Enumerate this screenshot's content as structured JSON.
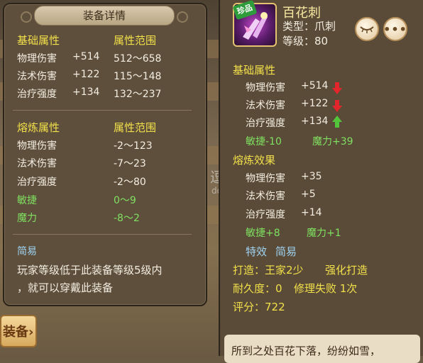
{
  "background": {
    "left_button_label": "装备",
    "left_button_icon": "chevron-right-icon"
  },
  "detail_panel": {
    "title": "装备详情",
    "base": {
      "header": "基础属性",
      "range_header": "属性范围",
      "rows": [
        {
          "name": "物理伤害",
          "value": "+514",
          "range": "512～658"
        },
        {
          "name": "法术伤害",
          "value": "+122",
          "range": "115～148"
        },
        {
          "name": "治疗强度",
          "value": "+134",
          "range": "132～237"
        }
      ]
    },
    "refine": {
      "header": "熔炼属性",
      "range_header": "属性范围",
      "rows": [
        {
          "name": "物理伤害",
          "range": "-2～123"
        },
        {
          "name": "法术伤害",
          "range": "-7～23"
        },
        {
          "name": "治疗强度",
          "range": "-2～80"
        },
        {
          "name": "敏捷",
          "range": "0～9"
        },
        {
          "name": "魔力",
          "range": "-8～2"
        }
      ]
    },
    "simple": {
      "header": "简易",
      "text_line1": "玩家等级低于此装备等级5级内",
      "text_line2": "，就可以穿戴此装备"
    }
  },
  "item_panel": {
    "rarity_badge": "珍品",
    "name": "百花刺",
    "type_line": "类型：爪刺",
    "level_line": "等级：80",
    "icon_buttons": [
      "eye-closed-icon",
      "more-icon"
    ],
    "base": {
      "header": "基础属性",
      "rows": [
        {
          "name": "物理伤害",
          "value": "+514",
          "trend": "down"
        },
        {
          "name": "法术伤害",
          "value": "+122",
          "trend": "down"
        },
        {
          "name": "治疗强度",
          "value": "+134",
          "trend": "up"
        }
      ],
      "extra": [
        "敏捷-10",
        "魔力+39"
      ]
    },
    "refine": {
      "header": "熔炼效果",
      "rows": [
        {
          "name": "物理伤害",
          "value": "+35"
        },
        {
          "name": "法术伤害",
          "value": "+5"
        },
        {
          "name": "治疗强度",
          "value": "+14"
        }
      ],
      "extra": [
        "敏捷+8",
        "魔力+1"
      ]
    },
    "special_label": "特效",
    "special_value": "简易",
    "craft_line": "打造：王家2少",
    "craft_extra": "强化打造",
    "durability_line": "耐久度：0",
    "repair_line": "修理失败 1次",
    "score_line": "评分：722",
    "description": "所到之处百花下落，纷纷如雪，"
  },
  "colors": {
    "header_yellow": "#f2e04a",
    "green": "#7fe061",
    "blue": "#9ed3f2",
    "item_name": "#f7e9a0",
    "down_arrow": "#e3262b",
    "up_arrow": "#52c53b"
  }
}
